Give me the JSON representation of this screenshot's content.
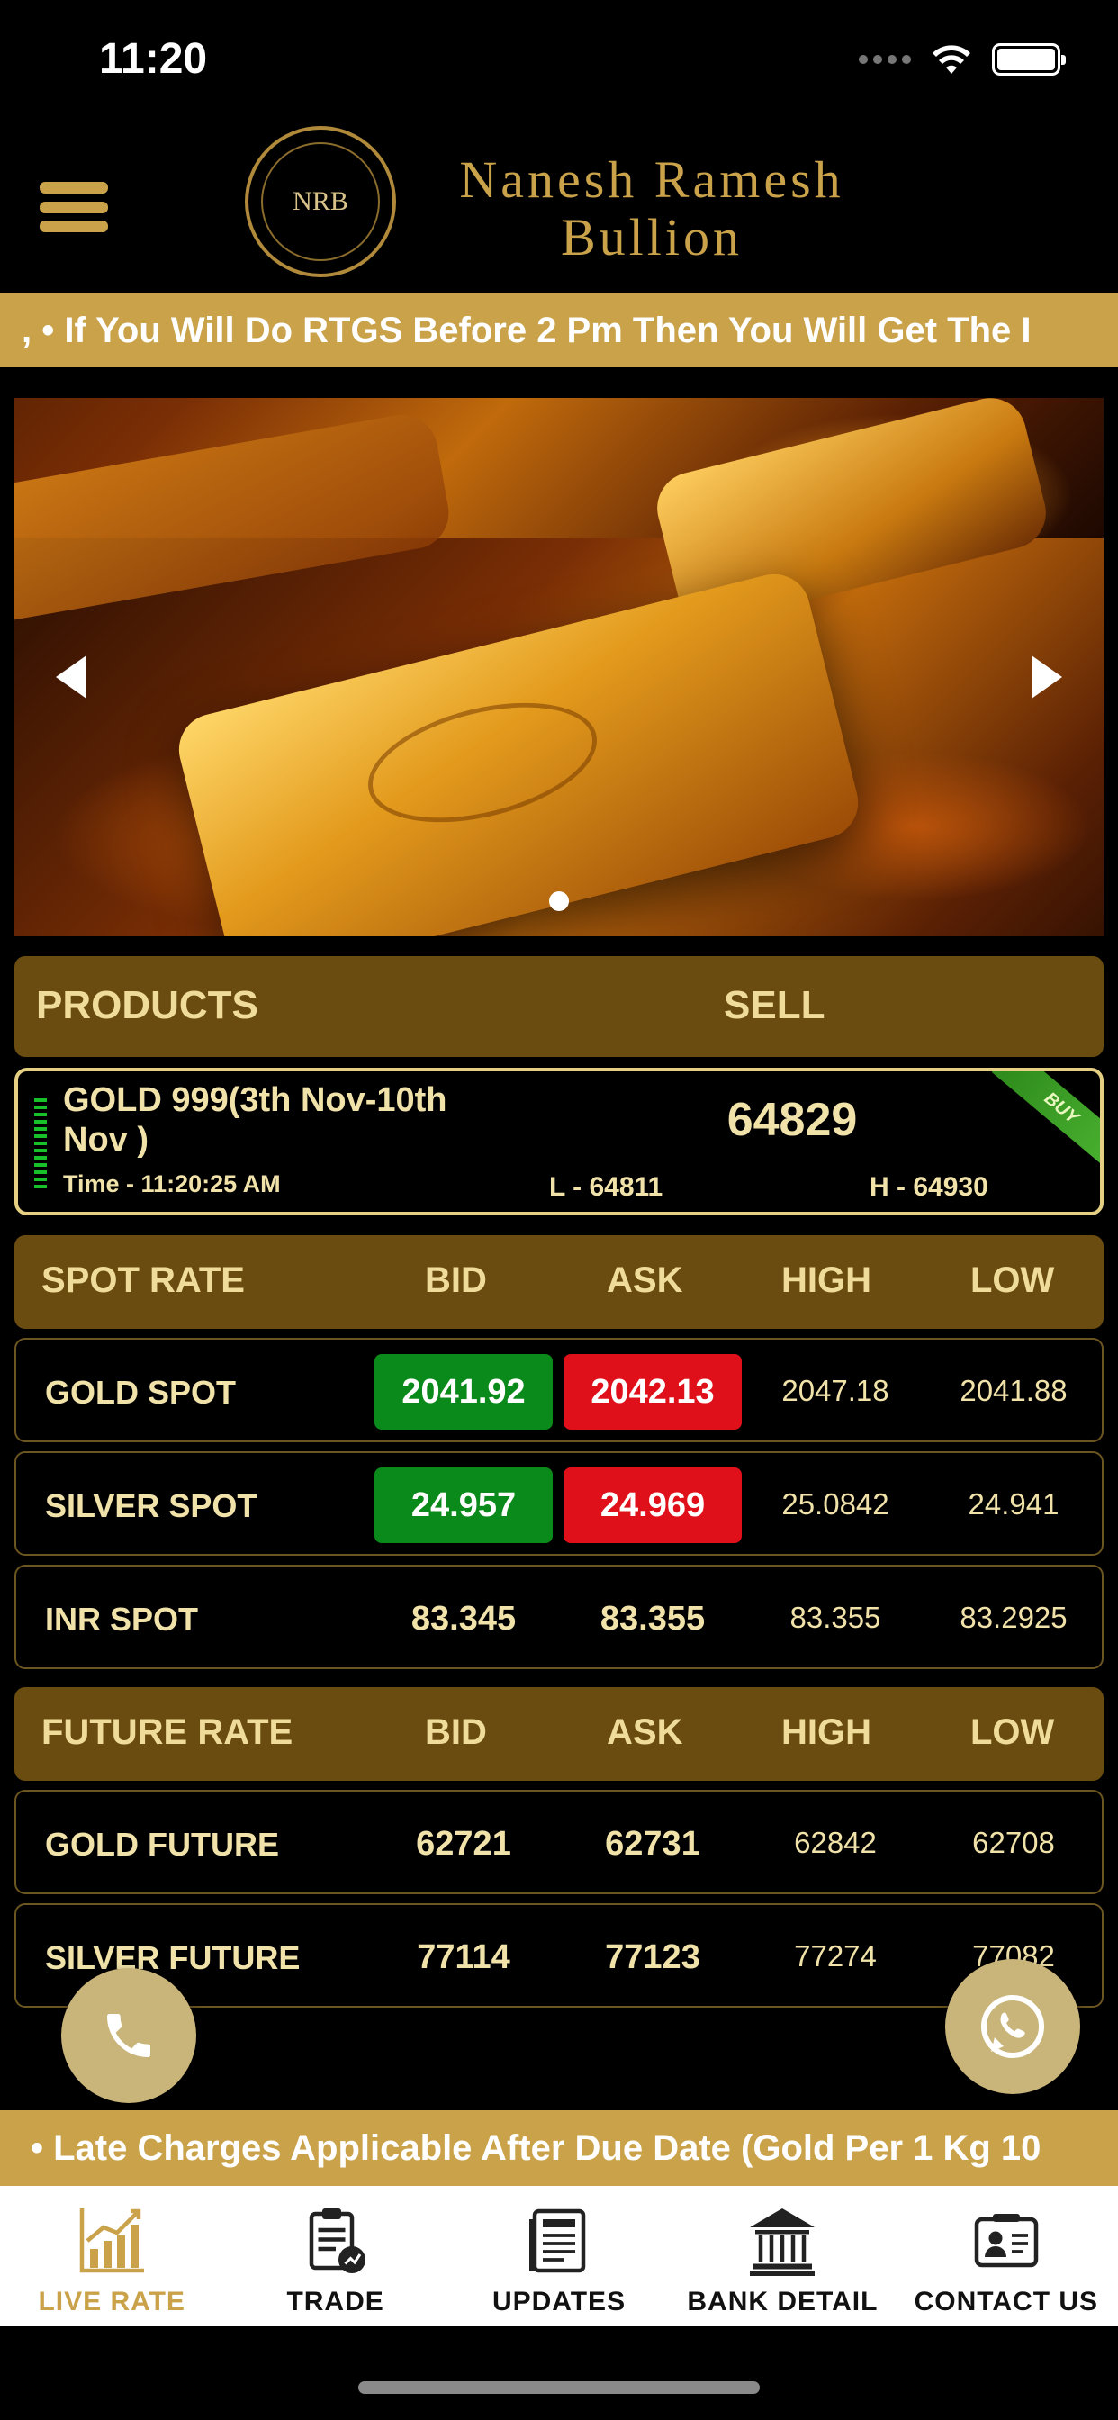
{
  "status_bar": {
    "time": "11:20"
  },
  "header": {
    "logo_text": "NRB",
    "brand_line1": "Nanesh Ramesh",
    "brand_line2": "Bullion"
  },
  "ticker_top": ", • If You Will  Do RTGS Before 2 Pm Then You Will Get The I",
  "products_header": {
    "products_label": "PRODUCTS",
    "sell_label": "SELL"
  },
  "product": {
    "name": "GOLD 999(3th  Nov-10th Nov )",
    "time": "Time - 11:20:25 AM",
    "sell": "64829",
    "low": "L - 64811",
    "high": "H - 64930",
    "badge": "BUY"
  },
  "spot_header": {
    "title": "SPOT RATE",
    "bid": "BID",
    "ask": "ASK",
    "high": "HIGH",
    "low": "LOW"
  },
  "spot_rows": [
    {
      "name": "GOLD SPOT",
      "bid": "2041.92",
      "ask": "2042.13",
      "high": "2047.18",
      "low": "2041.88"
    },
    {
      "name": "SILVER SPOT",
      "bid": "24.957",
      "ask": "24.969",
      "high": "25.0842",
      "low": "24.941"
    },
    {
      "name": "INR SPOT",
      "bid": "83.345",
      "ask": "83.355",
      "high": "83.355",
      "low": "83.2925"
    }
  ],
  "future_header": {
    "title": "FUTURE RATE",
    "bid": "BID",
    "ask": "ASK",
    "high": "HIGH",
    "low": "LOW"
  },
  "future_rows": [
    {
      "name": "GOLD FUTURE",
      "bid": "62721",
      "ask": "62731",
      "high": "62842",
      "low": "62708"
    },
    {
      "name": "SILVER FUTURE",
      "bid": "77114",
      "ask": "77123",
      "high": "77274",
      "low": "77082"
    }
  ],
  "ticker_bottom": "• Late Charges Applicable After Due Date (Gold Per 1 Kg 10",
  "nav": [
    {
      "label": "LIVE RATE",
      "icon": "chart-icon"
    },
    {
      "label": "TRADE",
      "icon": "trade-icon"
    },
    {
      "label": "UPDATES",
      "icon": "newspaper-icon"
    },
    {
      "label": "BANK DETAIL",
      "icon": "bank-icon"
    },
    {
      "label": "CONTACT US",
      "icon": "contact-card-icon"
    }
  ],
  "colors": {
    "gold": "#c9a24a",
    "header_brown": "#6b4c10",
    "bid_green": "#0a8a1a",
    "ask_red": "#e0101a",
    "text_cream": "#f0e2a8"
  }
}
